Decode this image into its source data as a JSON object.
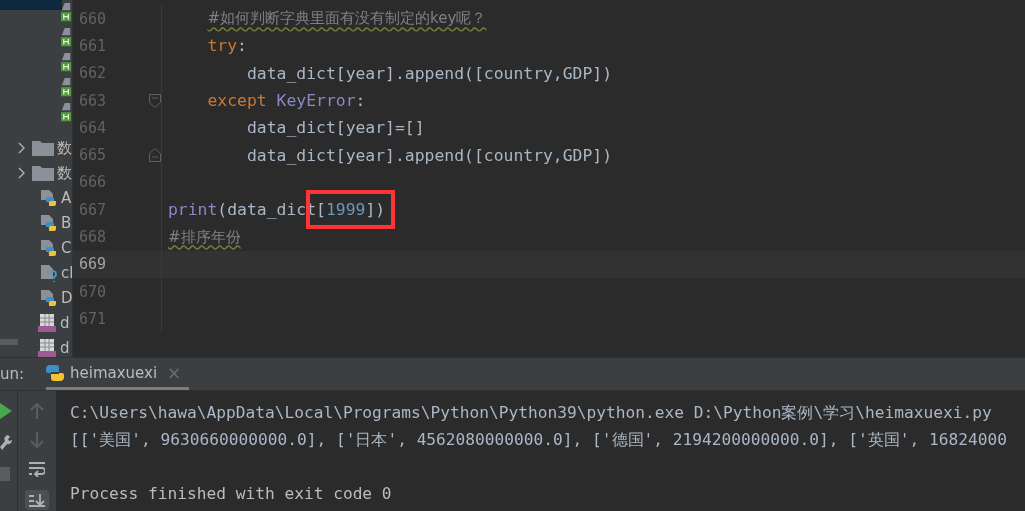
{
  "project_tree": {
    "items": [
      {
        "kind": "html"
      },
      {
        "kind": "html"
      },
      {
        "kind": "html"
      },
      {
        "kind": "html"
      },
      {
        "kind": "html"
      },
      {
        "kind": "folder",
        "name": "数",
        "expanded": false
      },
      {
        "kind": "folder",
        "name": "数",
        "expanded": false
      },
      {
        "kind": "python",
        "name": "A"
      },
      {
        "kind": "python",
        "name": "B"
      },
      {
        "kind": "python",
        "name": "C"
      },
      {
        "kind": "unknown",
        "name": "cl"
      },
      {
        "kind": "python",
        "name": "D"
      },
      {
        "kind": "csv",
        "name": "d"
      },
      {
        "kind": "csv",
        "name": "d"
      }
    ]
  },
  "editor": {
    "lines": [
      {
        "number": "660",
        "current": false,
        "fold_start": false,
        "fold_end": false,
        "tokens": [
          {
            "kind": "comment",
            "text": "    #如何判断字典里面有没有制定的key呢？"
          }
        ]
      },
      {
        "number": "661",
        "current": false,
        "fold_start": false,
        "fold_end": false,
        "tokens": [
          {
            "kind": "keyword",
            "text": "    try"
          },
          {
            "kind": "plain",
            "text": ":"
          }
        ]
      },
      {
        "number": "662",
        "current": false,
        "fold_start": false,
        "fold_end": false,
        "tokens": [
          {
            "kind": "plain",
            "text": "        data_dict[year].append([country,GDP])"
          }
        ]
      },
      {
        "number": "663",
        "current": false,
        "fold_start": true,
        "fold_end": false,
        "tokens": [
          {
            "kind": "keyword",
            "text": "    except "
          },
          {
            "kind": "builtin",
            "text": "KeyError"
          },
          {
            "kind": "plain",
            "text": ":"
          }
        ]
      },
      {
        "number": "664",
        "current": false,
        "fold_start": false,
        "fold_end": false,
        "tokens": [
          {
            "kind": "plain",
            "text": "        data_dict[year]=[]"
          }
        ]
      },
      {
        "number": "665",
        "current": false,
        "fold_start": false,
        "fold_end": true,
        "tokens": [
          {
            "kind": "plain",
            "text": "        data_dict[year].append([country,GDP])"
          }
        ]
      },
      {
        "number": "666",
        "current": false,
        "fold_start": false,
        "fold_end": false
      },
      {
        "number": "667",
        "current": false,
        "fold_start": false,
        "fold_end": false,
        "tokens": [
          {
            "kind": "builtin",
            "text": "print"
          },
          {
            "kind": "plain",
            "text": "(data_dict"
          },
          {
            "kind": "plain",
            "text": "[",
            "boxed": true
          },
          {
            "kind": "number",
            "text": "1999",
            "boxed": true
          },
          {
            "kind": "plain",
            "text": "])",
            "boxed": true
          }
        ]
      },
      {
        "number": "668",
        "current": false,
        "fold_start": false,
        "fold_end": false,
        "tokens": [
          {
            "kind": "comment",
            "text": "#排序年份"
          }
        ]
      },
      {
        "number": "669",
        "current": true,
        "fold_start": false,
        "fold_end": false
      },
      {
        "number": "670",
        "current": false,
        "fold_start": false,
        "fold_end": false
      },
      {
        "number": "671",
        "current": false,
        "fold_start": false,
        "fold_end": false
      }
    ]
  },
  "run_panel": {
    "label": "un:",
    "tabs": [
      {
        "label": "heimaxuexi",
        "close": "×",
        "selected": true
      }
    ],
    "console": [
      "C:\\Users\\hawa\\AppData\\Local\\Programs\\Python\\Python39\\python.exe D:\\Python案例\\学习\\heimaxuexi.py",
      "[['美国', 9630660000000.0], ['日本', 4562080000000.0], ['德国', 2194200000000.0], ['英国', 16824000",
      "Process finished with exit code 0"
    ]
  }
}
